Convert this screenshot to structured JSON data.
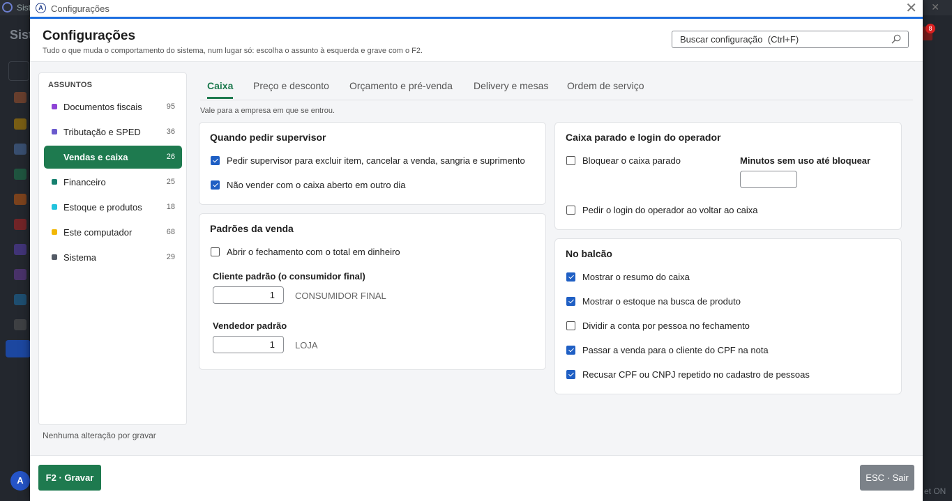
{
  "background_app": {
    "title_fragment": "Sist",
    "window_title_fragment": "Sist",
    "avatar_initial": "A",
    "notification_count": "8",
    "status_fragment": "et ON"
  },
  "window": {
    "title": "Configurações"
  },
  "header": {
    "title": "Configurações",
    "subtitle": "Tudo o que muda o comportamento do sistema, num lugar só: escolha o assunto à esquerda e grave com o F2.",
    "search_placeholder": "Buscar configuração  (Ctrl+F)"
  },
  "sidebar": {
    "heading": "ASSUNTOS",
    "items": [
      {
        "label": "Documentos fiscais",
        "count": "95",
        "color": "#8e44d6"
      },
      {
        "label": "Tributação e SPED",
        "count": "36",
        "color": "#6a5acd"
      },
      {
        "label": "Vendas e caixa",
        "count": "26",
        "color": "#1e7a4f",
        "active": true
      },
      {
        "label": "Financeiro",
        "count": "25",
        "color": "#16806f"
      },
      {
        "label": "Estoque e produtos",
        "count": "18",
        "color": "#22c3dd"
      },
      {
        "label": "Este computador",
        "count": "68",
        "color": "#f2b705"
      },
      {
        "label": "Sistema",
        "count": "29",
        "color": "#545b66"
      }
    ],
    "pending_status": "Nenhuma alteração por gravar"
  },
  "tabs": [
    {
      "label": "Caixa",
      "active": true
    },
    {
      "label": "Preço e desconto"
    },
    {
      "label": "Orçamento e pré-venda"
    },
    {
      "label": "Delivery e mesas"
    },
    {
      "label": "Ordem de serviço"
    }
  ],
  "scope_note": "Vale para a empresa em que se entrou.",
  "cards": {
    "supervisor": {
      "title": "Quando pedir supervisor",
      "options": [
        {
          "label": "Pedir supervisor para excluir item, cancelar a venda, sangria e suprimento",
          "checked": true
        },
        {
          "label": "Não vender com o caixa aberto em outro dia",
          "checked": true
        }
      ]
    },
    "sale_defaults": {
      "title": "Padrões da venda",
      "options": [
        {
          "label": "Abrir o fechamento com o total em dinheiro",
          "checked": false
        }
      ],
      "default_customer_label": "Cliente padrão (o consumidor final)",
      "default_customer_value": "1",
      "default_customer_name": "CONSUMIDOR FINAL",
      "default_seller_label": "Vendedor padrão",
      "default_seller_value": "1",
      "default_seller_name": "LOJA"
    },
    "idle": {
      "title": "Caixa parado e login do operador",
      "lock_label": "Bloquear o caixa parado",
      "lock_checked": false,
      "minutes_label": "Minutos sem uso até bloquear",
      "minutes_value": "",
      "login_label": "Pedir o login do operador ao voltar ao caixa",
      "login_checked": false
    },
    "counter": {
      "title": "No balcão",
      "options": [
        {
          "label": "Mostrar o resumo do caixa",
          "checked": true
        },
        {
          "label": "Mostrar o estoque na busca de produto",
          "checked": true
        },
        {
          "label": "Dividir a conta por pessoa no fechamento",
          "checked": false
        },
        {
          "label": "Passar a venda para o cliente do CPF na nota",
          "checked": true
        },
        {
          "label": "Recusar CPF ou CNPJ repetido no cadastro de pessoas",
          "checked": true
        }
      ]
    }
  },
  "footer": {
    "save_label": "F2 · Gravar",
    "exit_label": "ESC · Sair"
  },
  "colors": {
    "accent_green": "#1e7a4f",
    "checkbox_blue": "#1f5fc4",
    "title_bar_blue": "#1d6fe0"
  }
}
